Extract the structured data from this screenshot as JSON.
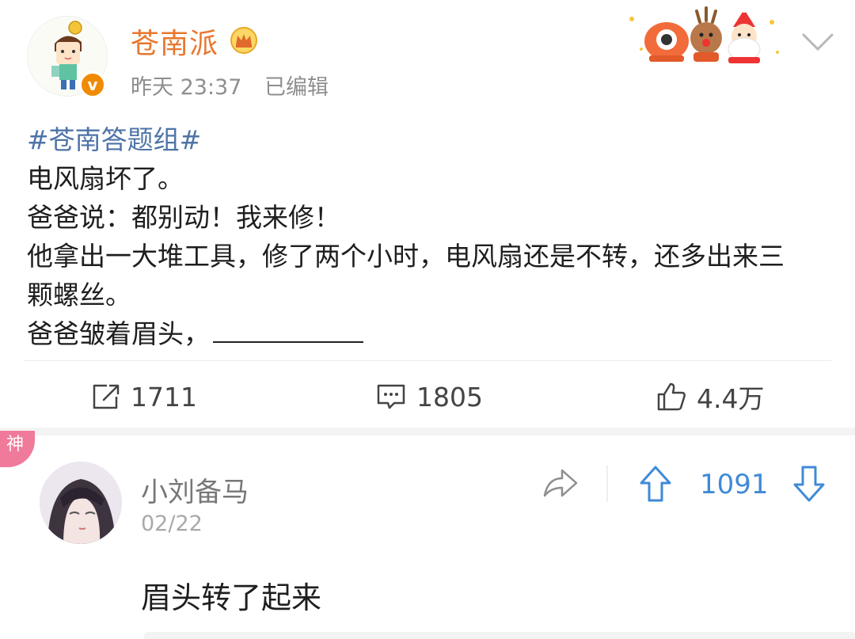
{
  "post": {
    "username": "苍南派",
    "time": "昨天 23:37",
    "edited": "已编辑",
    "verified_mark": "v",
    "hashtag": "#苍南答题组#",
    "lines": [
      "电风扇坏了。",
      "爸爸说：都别动！我来修！",
      "他拿出一大堆工具，修了两个小时，电风扇还是不转，还多出来三",
      "颗螺丝。",
      "爸爸皱着眉头，"
    ]
  },
  "actions": {
    "reposts": "1711",
    "comments": "1805",
    "likes": "4.4万"
  },
  "comment": {
    "badge": "神",
    "username": "小刘备马",
    "date": "02/22",
    "votes": "1091",
    "text": "眉头转了起来"
  },
  "colors": {
    "username": "#e8772e",
    "hashtag": "#4e74a8",
    "vote_blue": "#3f8ad6",
    "badge_pink": "#f07a9a",
    "verified_orange": "#f08a00"
  },
  "icons": [
    "crown-icon",
    "decoration-stickers",
    "chevron-down-icon",
    "repost-icon",
    "comment-icon",
    "like-icon",
    "share-icon",
    "upvote-icon",
    "downvote-icon"
  ]
}
